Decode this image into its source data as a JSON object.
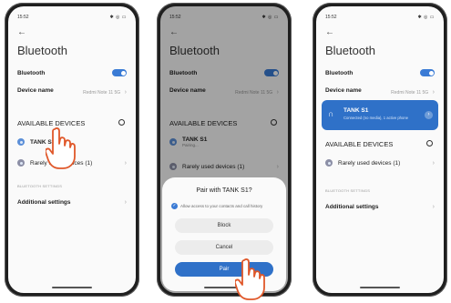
{
  "phone1": {
    "status_time": "15:52",
    "status_icons": "✱ ◎ ▭",
    "title": "Bluetooth",
    "bluetooth_label": "Bluetooth",
    "device_name_label": "Device name",
    "device_name_value": "Redmi Note 11 5G",
    "available_title": "AVAILABLE DEVICES",
    "devices": [
      {
        "name": "TANK S1"
      },
      {
        "name": "Rarely used devices (1)"
      }
    ],
    "settings_caps": "BLUETOOTH SETTINGS",
    "additional_settings": "Additional settings"
  },
  "phone2": {
    "status_time": "15:52",
    "status_icons": "✱ ◎ ▭",
    "title": "Bluetooth",
    "bluetooth_label": "Bluetooth",
    "device_name_label": "Device name",
    "device_name_value": "Redmi Note 11 5G",
    "available_title": "AVAILABLE DEVICES",
    "device_name": "TANK S1",
    "device_status": "Pairing...",
    "rarely_used": "Rarely used devices (1)",
    "dialog": {
      "title": "Pair with TANK S1?",
      "checkbox_text": "Allow access to your contacts and call history",
      "block": "Block",
      "cancel": "Cancel",
      "pair": "Pair"
    }
  },
  "phone3": {
    "status_time": "15:52",
    "status_icons": "✱ ◎ ▭",
    "title": "Bluetooth",
    "bluetooth_label": "Bluetooth",
    "device_name_label": "Device name",
    "device_name_value": "Redmi Note 11 5G",
    "connected": {
      "name": "TANK S1",
      "status": "Connected (no media), 1 active phone"
    },
    "available_title": "AVAILABLE DEVICES",
    "rarely_used": "Rarely used devices (1)",
    "settings_caps": "BLUETOOTH SETTINGS",
    "additional_settings": "Additional settings"
  },
  "colors": {
    "accent": "#3a7bd5",
    "connected_card": "#2f71c8",
    "hand_fill": "#ffffff",
    "hand_outline": "#e0582a"
  }
}
